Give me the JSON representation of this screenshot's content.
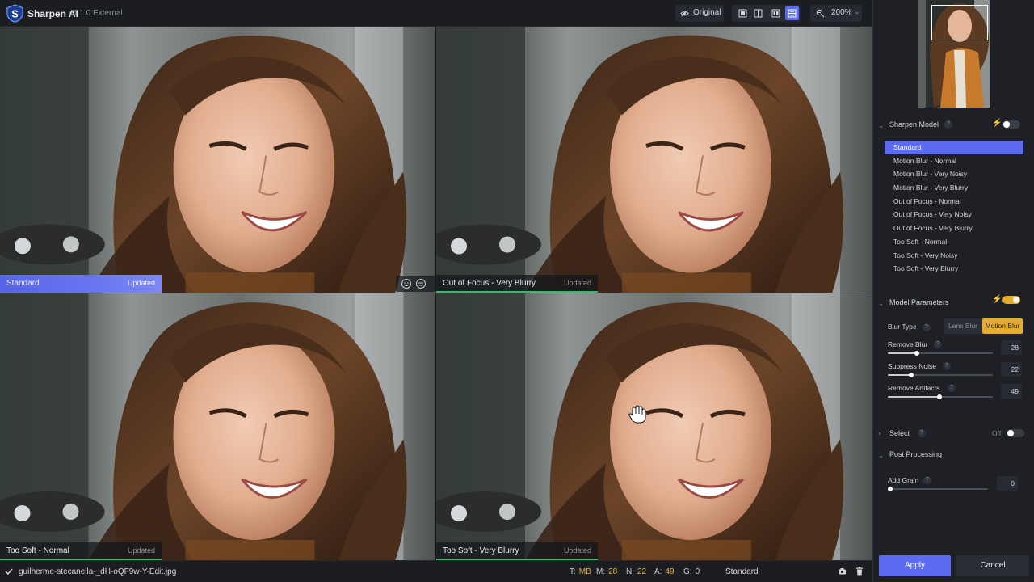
{
  "app": {
    "title": "Sharpen AI",
    "version": "v4.1.0 External"
  },
  "toolbar": {
    "original_label": "Original",
    "view_modes": [
      "single-view",
      "split-view",
      "side-by-side-view",
      "quad-view"
    ],
    "active_view": "quad-view",
    "zoom": "200%"
  },
  "previews": [
    {
      "name": "Standard",
      "status": "Updated",
      "active": true
    },
    {
      "name": "Out of Focus - Very Blurry",
      "status": "Updated",
      "active": false
    },
    {
      "name": "Too Soft - Normal",
      "status": "Updated",
      "active": false
    },
    {
      "name": "Too Soft - Very Blurry",
      "status": "Updated",
      "active": false
    }
  ],
  "statusbar": {
    "filename": "guilherme-stecanella-_dH-oQF9w-Y-Edit.jpg",
    "stats": [
      {
        "key": "T:",
        "value": "MB"
      },
      {
        "key": "M:",
        "value": "28"
      },
      {
        "key": "N:",
        "value": "22"
      },
      {
        "key": "A:",
        "value": "49"
      },
      {
        "key": "G:",
        "value": "0"
      }
    ],
    "model": "Standard"
  },
  "panel": {
    "sharpen_model": {
      "title": "Sharpen Model",
      "help": "?",
      "auto_enabled": false,
      "models": [
        "Standard",
        "Motion Blur - Normal",
        "Motion Blur - Very Noisy",
        "Motion Blur - Very Blurry",
        "Out of Focus - Normal",
        "Out of Focus - Very Noisy",
        "Out of Focus - Very Blurry",
        "Too Soft - Normal",
        "Too Soft - Very Noisy",
        "Too Soft - Very Blurry"
      ],
      "selected": "Standard"
    },
    "model_parameters": {
      "title": "Model Parameters",
      "auto_enabled": true,
      "blur_type_label": "Blur Type",
      "blur_types": [
        "Lens Blur",
        "Motion Blur"
      ],
      "selected_blur_type": "Motion Blur",
      "sliders": [
        {
          "label": "Remove Blur",
          "value": 28
        },
        {
          "label": "Suppress Noise",
          "value": 22
        },
        {
          "label": "Remove Artifacts",
          "value": 49
        }
      ]
    },
    "select": {
      "title": "Select",
      "state_label": "Off",
      "enabled": false
    },
    "post_processing": {
      "title": "Post Processing",
      "sliders": [
        {
          "label": "Add Grain",
          "value": 0
        }
      ]
    },
    "apply_label": "Apply",
    "cancel_label": "Cancel"
  },
  "colors": {
    "accent": "#5b6cf2",
    "highlight": "#e5ac2e",
    "updated_bar": "#3fb46a"
  }
}
